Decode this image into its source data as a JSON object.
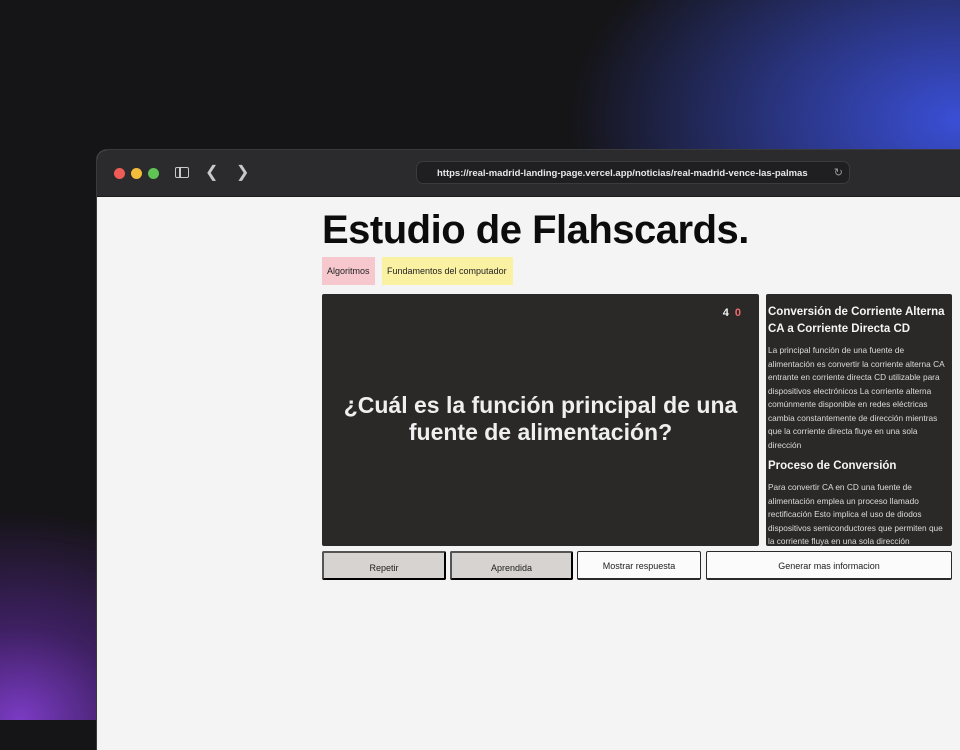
{
  "browser": {
    "url": "https://real-madrid-landing-page.vercel.app/noticias/real-madrid-vence-las-palmas",
    "icons": {
      "sidebar": "sidebar-toggle-icon",
      "back": "chevron-left-icon",
      "forward": "chevron-right-icon",
      "reload": "reload-icon"
    }
  },
  "page": {
    "title": "Estudio de Flahscards.",
    "tags": [
      {
        "label": "Algoritmos",
        "color": "#f6c8cd"
      },
      {
        "label": "Fundamentos del computador",
        "color": "#fbf1a3"
      }
    ]
  },
  "card": {
    "correct_count": "4",
    "wrong_count": "0",
    "question": "¿Cuál es la función principal de una fuente de alimentación?"
  },
  "info_panel": {
    "sections": [
      {
        "heading": "Conversión de Corriente Alterna CA a Corriente Directa CD",
        "body": "La principal función de una fuente de alimentación es convertir la corriente alterna CA entrante en corriente directa CD utilizable para dispositivos electrónicos La corriente alterna comúnmente disponible en redes eléctricas cambia constantemente de dirección mientras que la corriente directa fluye en una sola dirección"
      },
      {
        "heading": "Proceso de Conversión",
        "body": "Para convertir CA en CD una fuente de alimentación emplea un proceso llamado rectificación Esto implica el uso de diodos dispositivos semiconductores que permiten que la corriente fluya en una sola dirección"
      }
    ]
  },
  "actions": {
    "repeat": "Repetir",
    "learned": "Aprendida",
    "show_answer": "Mostrar respuesta",
    "generate_more": "Generar mas informacion"
  },
  "colors": {
    "card_bg": "#2a2928",
    "wrong_count": "#f06a6a",
    "button_grey": "#d6d3d0"
  }
}
